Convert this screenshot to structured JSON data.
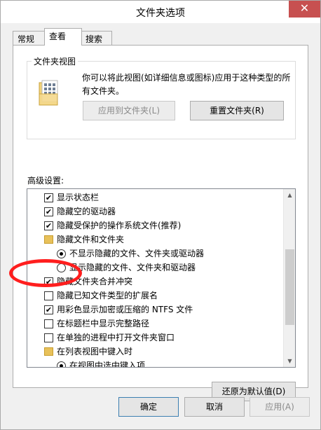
{
  "window": {
    "title": "文件夹选项",
    "close_glyph": "✕"
  },
  "tabs": [
    {
      "label": "常规",
      "active": false
    },
    {
      "label": "查看",
      "active": true
    },
    {
      "label": "搜索",
      "active": false
    }
  ],
  "folder_views": {
    "group_label": "文件夹视图",
    "description": "你可以将此视图(如详细信息或图标)应用于这种类型的所有文件夹。",
    "apply_button": "应用到文件夹(L)",
    "reset_button": "重置文件夹(R)"
  },
  "advanced": {
    "label": "高级设置:",
    "items": [
      {
        "type": "checkbox",
        "checked": true,
        "label": "显示状态栏"
      },
      {
        "type": "checkbox",
        "checked": true,
        "label": "隐藏空的驱动器"
      },
      {
        "type": "checkbox",
        "checked": true,
        "label": "隐藏受保护的操作系统文件(推荐)"
      },
      {
        "type": "folder",
        "label": "隐藏文件和文件夹"
      },
      {
        "type": "radio",
        "checked": true,
        "label": "不显示隐藏的文件、文件夹或驱动器"
      },
      {
        "type": "radio",
        "checked": false,
        "label": "显示隐藏的文件、文件夹和驱动器"
      },
      {
        "type": "checkbox",
        "checked": true,
        "label": "隐藏文件夹合并冲突"
      },
      {
        "type": "checkbox",
        "checked": false,
        "label": "隐藏已知文件类型的扩展名"
      },
      {
        "type": "checkbox",
        "checked": true,
        "label": "用彩色显示加密或压缩的 NTFS 文件"
      },
      {
        "type": "checkbox",
        "checked": false,
        "label": "在标题栏中显示完整路径"
      },
      {
        "type": "checkbox",
        "checked": false,
        "label": "在单独的进程中打开文件夹窗口"
      },
      {
        "type": "folder",
        "label": "在列表视图中键入时"
      },
      {
        "type": "radio",
        "checked": true,
        "label": "在视图中选中键入项"
      }
    ],
    "restore_defaults_button": "还原为默认值(D)"
  },
  "footer": {
    "ok_button": "确定",
    "cancel_button": "取消",
    "apply_button": "应用(A)"
  },
  "colors": {
    "annotation_circle": "#ff1e1e",
    "close_button": "#c75050"
  }
}
